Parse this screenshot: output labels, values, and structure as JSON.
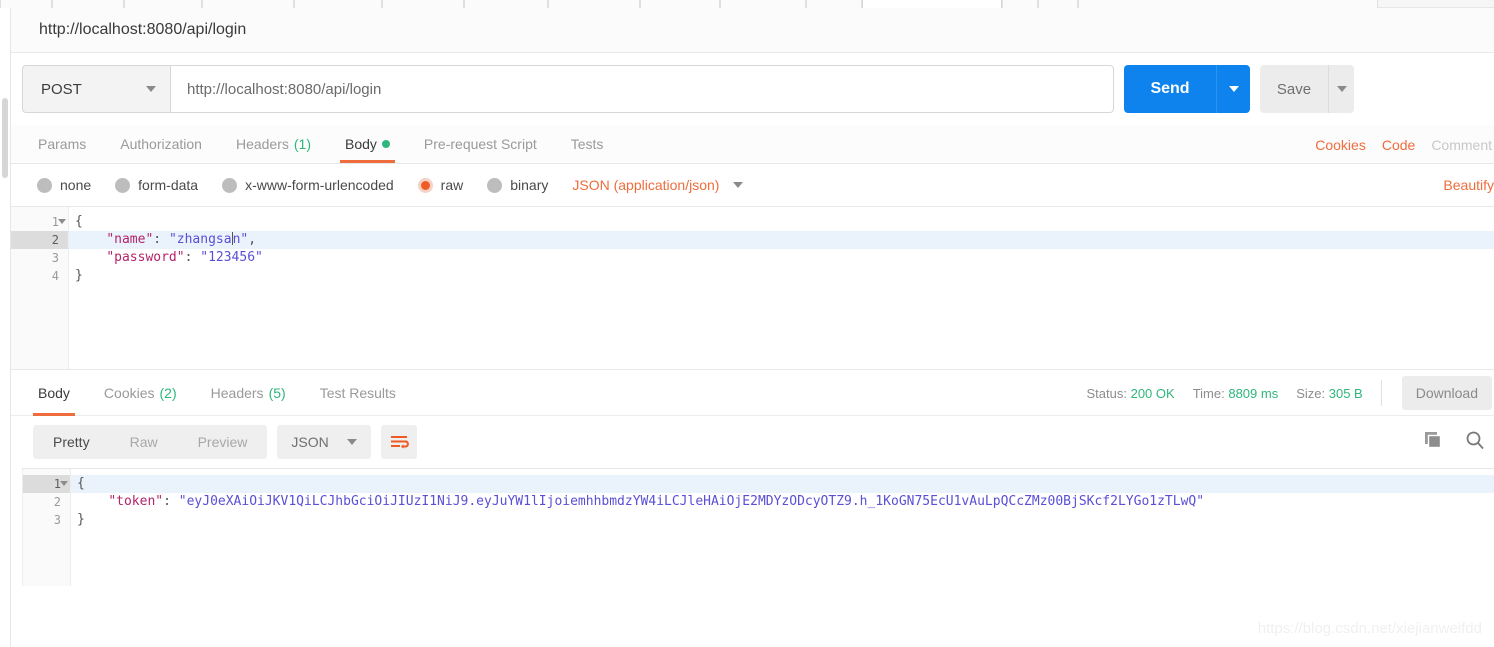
{
  "request": {
    "title": "http://localhost:8080/api/login",
    "method": "POST",
    "url": "http://localhost:8080/api/login",
    "send_label": "Send",
    "save_label": "Save",
    "tabs": [
      {
        "label": "Params",
        "count": "",
        "active": false,
        "dot": false
      },
      {
        "label": "Authorization",
        "count": "",
        "active": false,
        "dot": false
      },
      {
        "label": "Headers",
        "count": "(1)",
        "active": false,
        "dot": false
      },
      {
        "label": "Body",
        "count": "",
        "active": true,
        "dot": true
      },
      {
        "label": "Pre-request Script",
        "count": "",
        "active": false,
        "dot": false
      },
      {
        "label": "Tests",
        "count": "",
        "active": false,
        "dot": false
      }
    ],
    "tabs_right": {
      "cookies": "Cookies",
      "code": "Code",
      "comments": "Comment"
    },
    "body_types": [
      {
        "label": "none",
        "selected": false
      },
      {
        "label": "form-data",
        "selected": false
      },
      {
        "label": "x-www-form-urlencoded",
        "selected": false
      },
      {
        "label": "raw",
        "selected": true
      },
      {
        "label": "binary",
        "selected": false
      }
    ],
    "content_type": "JSON (application/json)",
    "beautify_label": "Beautify",
    "body_lines": [
      {
        "num": "1",
        "fold": true,
        "highlight": false,
        "segments": [
          {
            "t": "{",
            "c": "p"
          }
        ]
      },
      {
        "num": "2",
        "fold": false,
        "highlight": true,
        "segments": [
          {
            "t": "    ",
            "c": "p"
          },
          {
            "t": "\"name\"",
            "c": "k"
          },
          {
            "t": ": ",
            "c": "p"
          },
          {
            "t": "\"zhangsan\"",
            "c": "s"
          },
          {
            "t": ",",
            "c": "p"
          }
        ]
      },
      {
        "num": "3",
        "fold": false,
        "highlight": false,
        "segments": [
          {
            "t": "    ",
            "c": "p"
          },
          {
            "t": "\"password\"",
            "c": "k"
          },
          {
            "t": ": ",
            "c": "p"
          },
          {
            "t": "\"123456\"",
            "c": "s"
          }
        ]
      },
      {
        "num": "4",
        "fold": false,
        "highlight": false,
        "segments": [
          {
            "t": "}",
            "c": "p"
          }
        ]
      }
    ]
  },
  "response": {
    "tabs": [
      {
        "label": "Body",
        "count": "",
        "active": true
      },
      {
        "label": "Cookies",
        "count": "(2)",
        "active": false
      },
      {
        "label": "Headers",
        "count": "(5)",
        "active": false
      },
      {
        "label": "Test Results",
        "count": "",
        "active": false
      }
    ],
    "status_label": "Status:",
    "status_value": "200 OK",
    "time_label": "Time:",
    "time_value": "8809 ms",
    "size_label": "Size:",
    "size_value": "305 B",
    "download_label": "Download",
    "view_modes": [
      {
        "label": "Pretty",
        "active": true
      },
      {
        "label": "Raw",
        "active": false
      },
      {
        "label": "Preview",
        "active": false
      }
    ],
    "format": "JSON",
    "body_lines": [
      {
        "num": "1",
        "fold": true,
        "highlight": true,
        "segments": [
          {
            "t": "{",
            "c": "p"
          }
        ]
      },
      {
        "num": "2",
        "fold": false,
        "highlight": false,
        "segments": [
          {
            "t": "    ",
            "c": "p"
          },
          {
            "t": "\"token\"",
            "c": "k"
          },
          {
            "t": ": ",
            "c": "p"
          },
          {
            "t": "\"eyJ0eXAiOiJKV1QiLCJhbGciOiJIUzI1NiJ9.eyJuYW1lIjoiemhhbmdzYW4iLCJleHAiOjE2MDYzODcyOTZ9.h_1KoGN75EcU1vAuLpQCcZMz00BjSKcf2LYGo1zTLwQ\"",
            "c": "s"
          }
        ]
      },
      {
        "num": "3",
        "fold": false,
        "highlight": false,
        "segments": [
          {
            "t": "}",
            "c": "p"
          }
        ]
      }
    ]
  },
  "watermark": "https://blog.csdn.net/xiejianweifdd",
  "colors": {
    "accent_orange": "#ef6c3d",
    "send_blue": "#0e83ed",
    "status_green": "#2fb67c"
  }
}
